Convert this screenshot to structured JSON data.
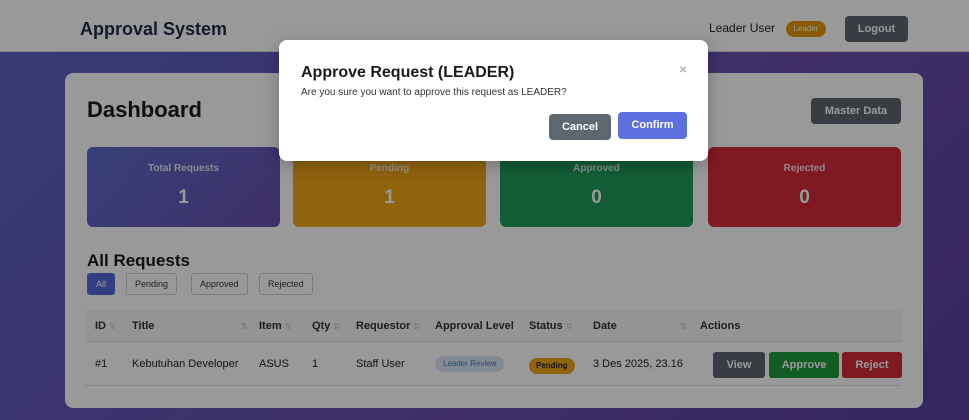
{
  "navbar": {
    "brand": "Approval System",
    "user": "Leader User",
    "role": "Leader",
    "logout": "Logout"
  },
  "dashboard": {
    "title": "Dashboard",
    "master_data": "Master Data",
    "stats": [
      {
        "label": "Total Requests",
        "value": "1",
        "color": "#5d6ac9"
      },
      {
        "label": "Pending",
        "value": "1",
        "color": "#f0a517"
      },
      {
        "label": "Approved",
        "value": "0",
        "color": "#1f9b5b"
      },
      {
        "label": "Rejected",
        "value": "0",
        "color": "#d42a3a"
      }
    ]
  },
  "requests": {
    "title": "All Requests",
    "filters": [
      "All",
      "Pending",
      "Approved",
      "Rejected"
    ],
    "columns": [
      "ID",
      "Title",
      "Item",
      "Qty",
      "Requestor",
      "Approval Level",
      "Status",
      "Date",
      "Actions"
    ],
    "rows": [
      {
        "id": "#1",
        "title": "Kebutuhan Developer",
        "item": "ASUS",
        "qty": "1",
        "requestor": "Staff User",
        "level": "Leader Review",
        "status": "Pending",
        "date": "3 Des 2025, 23.16",
        "actions": [
          "View",
          "Approve",
          "Reject"
        ]
      }
    ]
  },
  "modal": {
    "title": "Approve Request (LEADER)",
    "message": "Are you sure you want to approve this request as LEADER?",
    "cancel": "Cancel",
    "confirm": "Confirm",
    "close_icon": "×"
  }
}
